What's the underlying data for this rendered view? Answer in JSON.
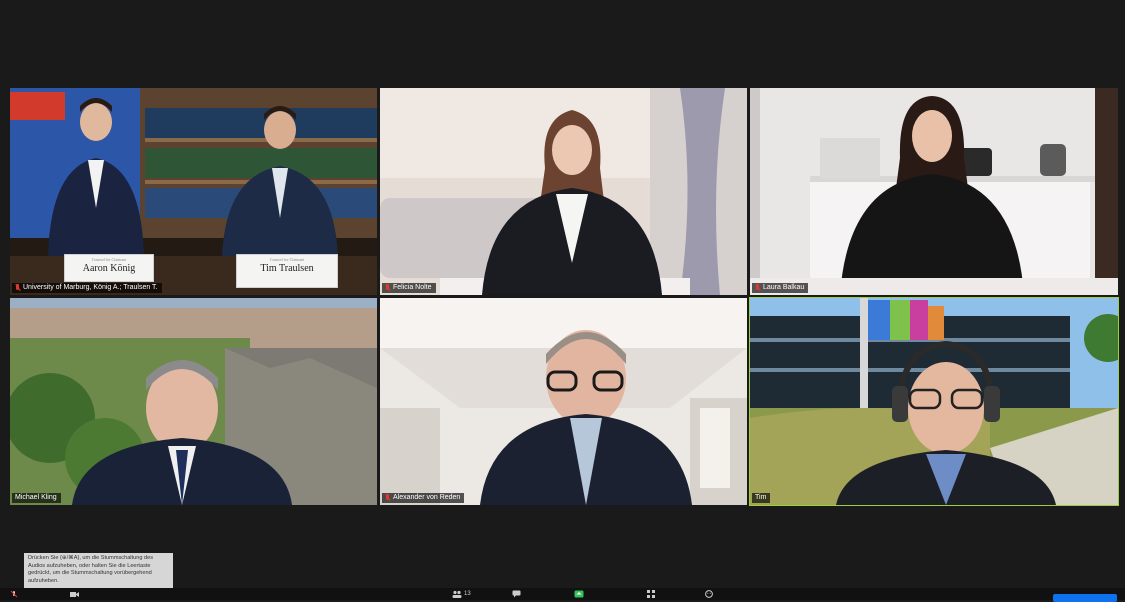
{
  "participants": [
    {
      "name": "University of Marburg, König A.; Traulsen T.",
      "muted": true,
      "active": false
    },
    {
      "name": "Felicia Nolte",
      "muted": true,
      "active": false
    },
    {
      "name": "Laura Balkau",
      "muted": true,
      "active": false
    },
    {
      "name": "Michael Kling",
      "muted": false,
      "active": false
    },
    {
      "name": "Alexander von Reden",
      "muted": true,
      "active": false
    },
    {
      "name": "Tim",
      "muted": false,
      "active": true
    }
  ],
  "placards": [
    {
      "header": "Counsel for Claimant",
      "name": "Aaron König"
    },
    {
      "header": "Counsel for Claimant",
      "name": "Tim Traulsen"
    }
  ],
  "tooltip": {
    "text": "Drücken Sie {⊕/⌘A}, um die Stummschaltung des Audios aufzuheben, oder halten Sie die Leertaste gedrückt, um die Stummschaltung vorübergehend aufzuheben."
  },
  "toolbar": {
    "participants_count": "13"
  },
  "colors": {
    "active_speaker_border": "#9ccf3c",
    "muted_icon": "#e0392b",
    "end_button": "#0e72ed"
  }
}
